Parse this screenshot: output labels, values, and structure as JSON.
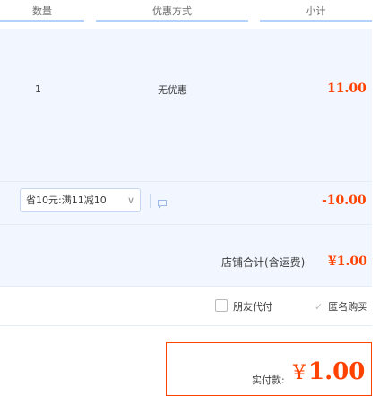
{
  "table_header": {
    "qty": "数量",
    "discount": "优惠方式",
    "subtotal": "小计"
  },
  "item": {
    "qty": "1",
    "discount": "无优惠",
    "subtotal": "11.00"
  },
  "coupon": {
    "selected": "省10元:满11减10",
    "discount_amount": "-10.00"
  },
  "shop_total": {
    "label": "店铺合计(含运费)",
    "amount": "¥1.00"
  },
  "options": {
    "friend_pay": "朋友代付",
    "anonymous": "匿名购买"
  },
  "payment": {
    "label": "实付款:",
    "currency": "¥",
    "amount": "1.00"
  },
  "colors": {
    "accent": "#ff4200",
    "panel_bg": "#f2f7ff",
    "header_rule": "#b2d1ff"
  }
}
